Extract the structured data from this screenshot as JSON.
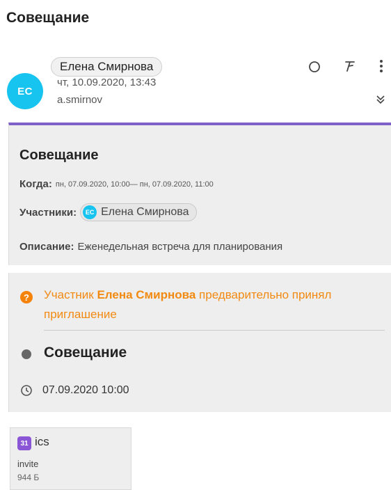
{
  "subject": "Совещание",
  "sender": {
    "initials": "ЕС",
    "name": "Елена Смирнова",
    "date": "чт, 10.09.2020, 13:43",
    "login": "a.smirnov"
  },
  "header_icons": {
    "mark_unread": "circle-icon",
    "flag": "flag-icon",
    "more": "more-vertical-icon",
    "expand": "double-chevron-down-icon"
  },
  "invite_card": {
    "title": "Совещание",
    "when_label": "Когда:",
    "when_value": "пн, 07.09.2020, 10:00— пн, 07.09.2020, 11:00",
    "participants_label": "Участники:",
    "participant_initials": "ЕС",
    "participant_name": "Елена Смирнова",
    "description_label": "Описание:",
    "description_value": "Еженедельная встреча для планирования"
  },
  "response_card": {
    "notice_prefix": "Участник",
    "notice_name": "Елена Смирнова",
    "notice_suffix": "предварительно принял приглашение",
    "event_title": "Совещание",
    "event_time": "07.09.2020 10:00"
  },
  "attachment": {
    "icon_text": "31",
    "extension": "ics",
    "name": "invite",
    "size": "944 Б"
  },
  "colors": {
    "accent_purple": "#7e62c8",
    "avatar_cyan": "#17c3ef",
    "notice_orange": "#f28a12",
    "calendar_icon": "#8a56d6"
  }
}
